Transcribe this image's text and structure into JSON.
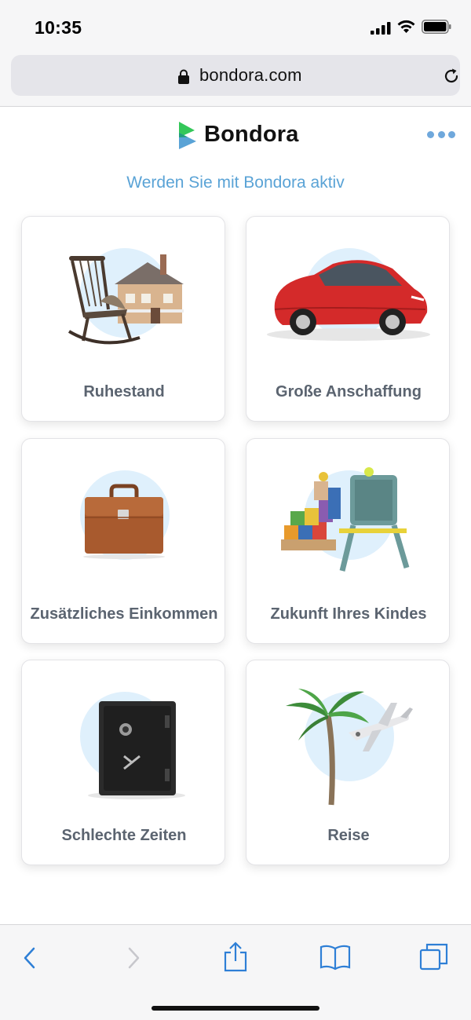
{
  "status_bar": {
    "time": "10:35"
  },
  "browser": {
    "url": "bondora.com"
  },
  "header": {
    "logo_text": "Bondora",
    "tagline": "Werden Sie mit Bondora aktiv"
  },
  "cards": [
    {
      "label": "Ruhestand",
      "image": "rocking-chair-and-house"
    },
    {
      "label": "Große Anschaffung",
      "image": "red-car"
    },
    {
      "label": "Zusätzliches Einkommen",
      "image": "briefcase"
    },
    {
      "label": "Zukunft Ihres Kindes",
      "image": "toy-blocks-and-easel"
    },
    {
      "label": "Schlechte Zeiten",
      "image": "safe"
    },
    {
      "label": "Reise",
      "image": "palm-tree-and-plane"
    }
  ],
  "colors": {
    "accent": "#5aa3d6",
    "label": "#5b6470",
    "bubble": "#dff0fc",
    "toolbar_icon": "#2e7fd6"
  },
  "toolbar": [
    "back-icon",
    "forward-icon",
    "share-icon",
    "bookmarks-icon",
    "tabs-icon"
  ]
}
